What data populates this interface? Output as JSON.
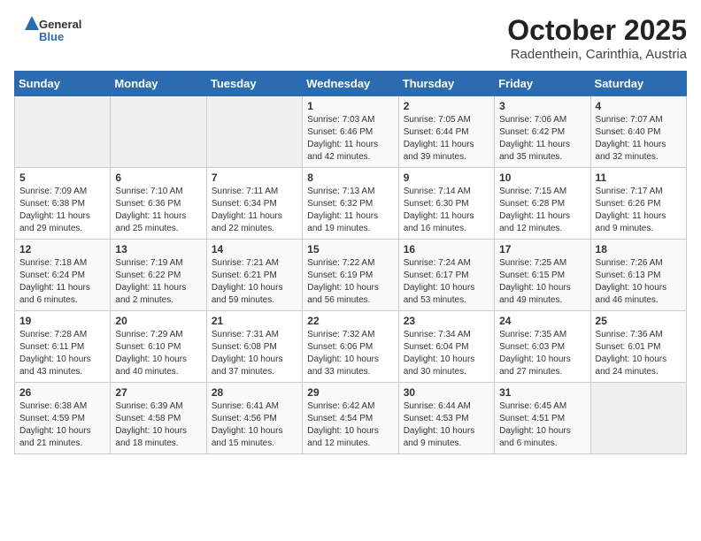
{
  "logo": {
    "general": "General",
    "blue": "Blue"
  },
  "title": {
    "month_year": "October 2025",
    "location": "Radenthein, Carinthia, Austria"
  },
  "weekdays": [
    "Sunday",
    "Monday",
    "Tuesday",
    "Wednesday",
    "Thursday",
    "Friday",
    "Saturday"
  ],
  "weeks": [
    [
      {
        "day": "",
        "sunrise": "",
        "sunset": "",
        "daylight": ""
      },
      {
        "day": "",
        "sunrise": "",
        "sunset": "",
        "daylight": ""
      },
      {
        "day": "",
        "sunrise": "",
        "sunset": "",
        "daylight": ""
      },
      {
        "day": "1",
        "sunrise": "Sunrise: 7:03 AM",
        "sunset": "Sunset: 6:46 PM",
        "daylight": "Daylight: 11 hours and 42 minutes."
      },
      {
        "day": "2",
        "sunrise": "Sunrise: 7:05 AM",
        "sunset": "Sunset: 6:44 PM",
        "daylight": "Daylight: 11 hours and 39 minutes."
      },
      {
        "day": "3",
        "sunrise": "Sunrise: 7:06 AM",
        "sunset": "Sunset: 6:42 PM",
        "daylight": "Daylight: 11 hours and 35 minutes."
      },
      {
        "day": "4",
        "sunrise": "Sunrise: 7:07 AM",
        "sunset": "Sunset: 6:40 PM",
        "daylight": "Daylight: 11 hours and 32 minutes."
      }
    ],
    [
      {
        "day": "5",
        "sunrise": "Sunrise: 7:09 AM",
        "sunset": "Sunset: 6:38 PM",
        "daylight": "Daylight: 11 hours and 29 minutes."
      },
      {
        "day": "6",
        "sunrise": "Sunrise: 7:10 AM",
        "sunset": "Sunset: 6:36 PM",
        "daylight": "Daylight: 11 hours and 25 minutes."
      },
      {
        "day": "7",
        "sunrise": "Sunrise: 7:11 AM",
        "sunset": "Sunset: 6:34 PM",
        "daylight": "Daylight: 11 hours and 22 minutes."
      },
      {
        "day": "8",
        "sunrise": "Sunrise: 7:13 AM",
        "sunset": "Sunset: 6:32 PM",
        "daylight": "Daylight: 11 hours and 19 minutes."
      },
      {
        "day": "9",
        "sunrise": "Sunrise: 7:14 AM",
        "sunset": "Sunset: 6:30 PM",
        "daylight": "Daylight: 11 hours and 16 minutes."
      },
      {
        "day": "10",
        "sunrise": "Sunrise: 7:15 AM",
        "sunset": "Sunset: 6:28 PM",
        "daylight": "Daylight: 11 hours and 12 minutes."
      },
      {
        "day": "11",
        "sunrise": "Sunrise: 7:17 AM",
        "sunset": "Sunset: 6:26 PM",
        "daylight": "Daylight: 11 hours and 9 minutes."
      }
    ],
    [
      {
        "day": "12",
        "sunrise": "Sunrise: 7:18 AM",
        "sunset": "Sunset: 6:24 PM",
        "daylight": "Daylight: 11 hours and 6 minutes."
      },
      {
        "day": "13",
        "sunrise": "Sunrise: 7:19 AM",
        "sunset": "Sunset: 6:22 PM",
        "daylight": "Daylight: 11 hours and 2 minutes."
      },
      {
        "day": "14",
        "sunrise": "Sunrise: 7:21 AM",
        "sunset": "Sunset: 6:21 PM",
        "daylight": "Daylight: 10 hours and 59 minutes."
      },
      {
        "day": "15",
        "sunrise": "Sunrise: 7:22 AM",
        "sunset": "Sunset: 6:19 PM",
        "daylight": "Daylight: 10 hours and 56 minutes."
      },
      {
        "day": "16",
        "sunrise": "Sunrise: 7:24 AM",
        "sunset": "Sunset: 6:17 PM",
        "daylight": "Daylight: 10 hours and 53 minutes."
      },
      {
        "day": "17",
        "sunrise": "Sunrise: 7:25 AM",
        "sunset": "Sunset: 6:15 PM",
        "daylight": "Daylight: 10 hours and 49 minutes."
      },
      {
        "day": "18",
        "sunrise": "Sunrise: 7:26 AM",
        "sunset": "Sunset: 6:13 PM",
        "daylight": "Daylight: 10 hours and 46 minutes."
      }
    ],
    [
      {
        "day": "19",
        "sunrise": "Sunrise: 7:28 AM",
        "sunset": "Sunset: 6:11 PM",
        "daylight": "Daylight: 10 hours and 43 minutes."
      },
      {
        "day": "20",
        "sunrise": "Sunrise: 7:29 AM",
        "sunset": "Sunset: 6:10 PM",
        "daylight": "Daylight: 10 hours and 40 minutes."
      },
      {
        "day": "21",
        "sunrise": "Sunrise: 7:31 AM",
        "sunset": "Sunset: 6:08 PM",
        "daylight": "Daylight: 10 hours and 37 minutes."
      },
      {
        "day": "22",
        "sunrise": "Sunrise: 7:32 AM",
        "sunset": "Sunset: 6:06 PM",
        "daylight": "Daylight: 10 hours and 33 minutes."
      },
      {
        "day": "23",
        "sunrise": "Sunrise: 7:34 AM",
        "sunset": "Sunset: 6:04 PM",
        "daylight": "Daylight: 10 hours and 30 minutes."
      },
      {
        "day": "24",
        "sunrise": "Sunrise: 7:35 AM",
        "sunset": "Sunset: 6:03 PM",
        "daylight": "Daylight: 10 hours and 27 minutes."
      },
      {
        "day": "25",
        "sunrise": "Sunrise: 7:36 AM",
        "sunset": "Sunset: 6:01 PM",
        "daylight": "Daylight: 10 hours and 24 minutes."
      }
    ],
    [
      {
        "day": "26",
        "sunrise": "Sunrise: 6:38 AM",
        "sunset": "Sunset: 4:59 PM",
        "daylight": "Daylight: 10 hours and 21 minutes."
      },
      {
        "day": "27",
        "sunrise": "Sunrise: 6:39 AM",
        "sunset": "Sunset: 4:58 PM",
        "daylight": "Daylight: 10 hours and 18 minutes."
      },
      {
        "day": "28",
        "sunrise": "Sunrise: 6:41 AM",
        "sunset": "Sunset: 4:56 PM",
        "daylight": "Daylight: 10 hours and 15 minutes."
      },
      {
        "day": "29",
        "sunrise": "Sunrise: 6:42 AM",
        "sunset": "Sunset: 4:54 PM",
        "daylight": "Daylight: 10 hours and 12 minutes."
      },
      {
        "day": "30",
        "sunrise": "Sunrise: 6:44 AM",
        "sunset": "Sunset: 4:53 PM",
        "daylight": "Daylight: 10 hours and 9 minutes."
      },
      {
        "day": "31",
        "sunrise": "Sunrise: 6:45 AM",
        "sunset": "Sunset: 4:51 PM",
        "daylight": "Daylight: 10 hours and 6 minutes."
      },
      {
        "day": "",
        "sunrise": "",
        "sunset": "",
        "daylight": ""
      }
    ]
  ]
}
